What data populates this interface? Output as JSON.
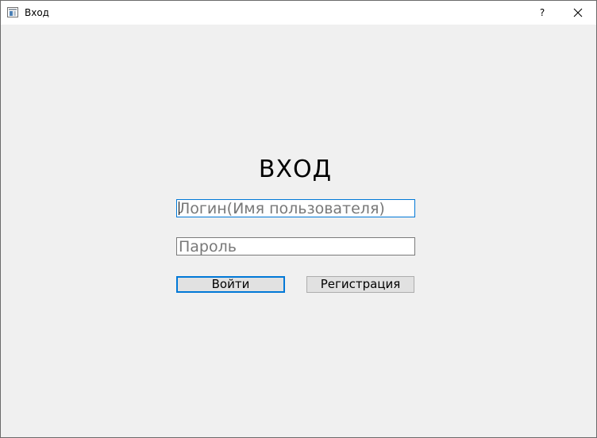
{
  "window": {
    "title": "Вход",
    "help_label": "?"
  },
  "form": {
    "heading": "ВХОД",
    "login_placeholder": "Логин(Имя пользователя)",
    "login_value": "",
    "password_placeholder": "Пароль",
    "password_value": "",
    "login_button": "Войти",
    "register_button": "Регистрация"
  },
  "colors": {
    "background": "#f0f0f0",
    "accent": "#0078d7",
    "button_face": "#e1e1e1"
  },
  "icons": [
    "app-window-icon",
    "close-icon"
  ]
}
